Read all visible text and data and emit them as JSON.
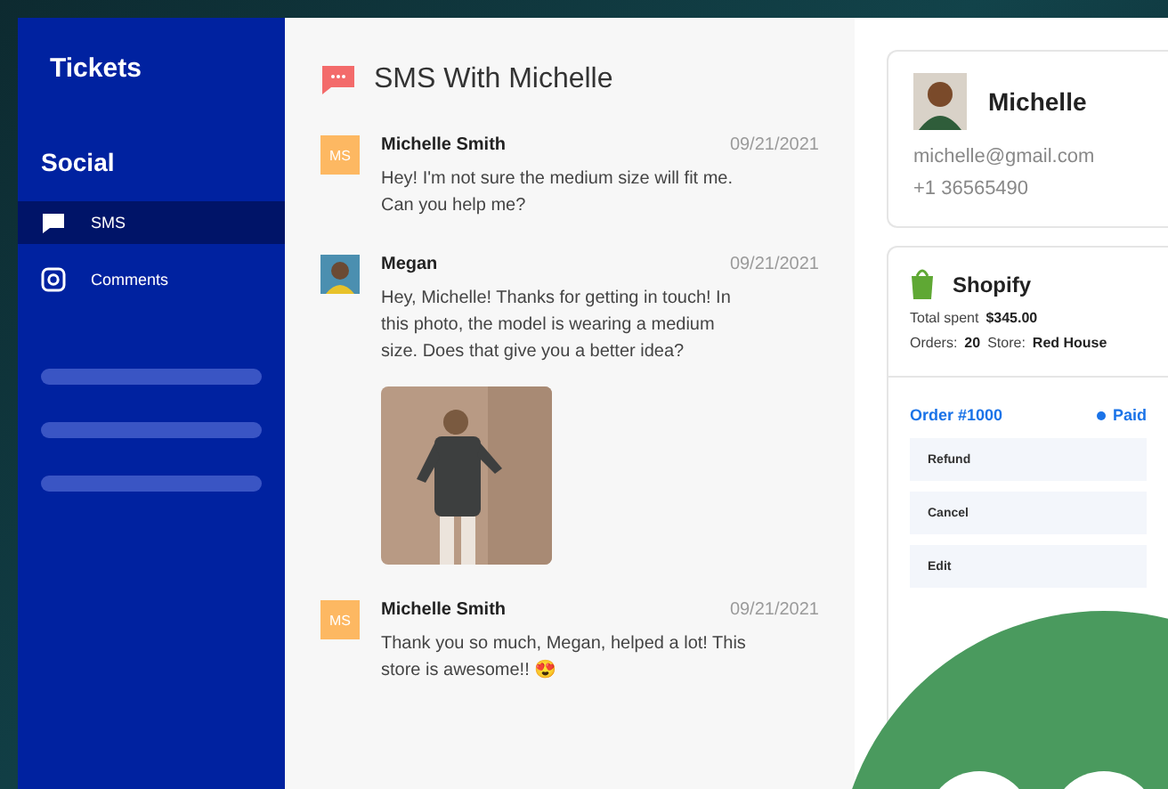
{
  "sidebar": {
    "title": "Tickets",
    "section": "Social",
    "items": [
      {
        "label": "SMS",
        "kind": "sms",
        "selected": true
      },
      {
        "label": "Comments",
        "kind": "comments",
        "selected": false
      }
    ]
  },
  "chat": {
    "title": "SMS With Michelle",
    "messages": [
      {
        "author": "Michelle Smith",
        "avatar": {
          "kind": "initials",
          "text": "MS"
        },
        "date": "09/21/2021",
        "text": "Hey! I'm not sure the medium size will fit me. Can you help me?"
      },
      {
        "author": "Megan",
        "date": "09/21/2021",
        "text": "Hey, Michelle! Thanks for getting in touch! In this photo, the model is wearing a medium size. Does that give you a better idea?"
      },
      {
        "author": "Michelle Smith",
        "avatar": {
          "kind": "initials",
          "text": "MS"
        },
        "date": "09/21/2021",
        "text": "Thank you so much, Megan, helped a lot! This store is awesome!! 😍"
      }
    ]
  },
  "contact": {
    "name": "Michelle",
    "email": "michelle@gmail.com",
    "phone": "+1 36565490"
  },
  "shop": {
    "name": "Shopify",
    "total_label": "Total spent",
    "total": "$345.00",
    "orders_label": "Orders:",
    "orders": "20",
    "store_label": "Store:",
    "store": "Red House",
    "order": {
      "number": "Order #1000",
      "status": "Paid",
      "actions": [
        "Refund",
        "Cancel",
        "Edit"
      ]
    }
  }
}
